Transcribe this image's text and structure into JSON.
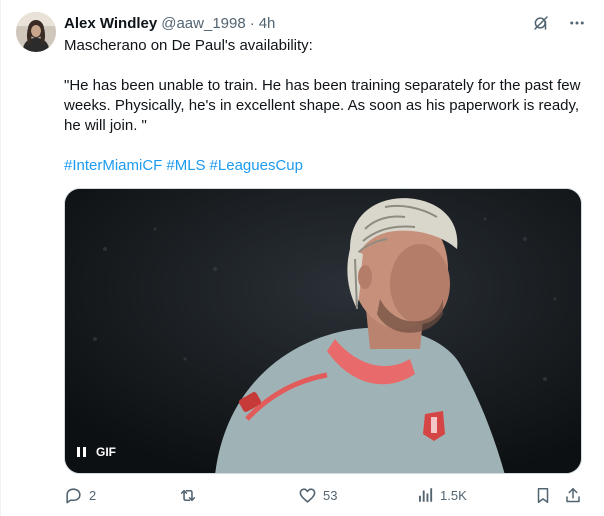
{
  "tweet": {
    "author_name": "Alex Windley",
    "handle": "@aaw_1998",
    "separator": "·",
    "time": "4h",
    "text_intro": "Mascherano on De Paul's availability:",
    "text_quote": "\"He has been unable to train. He has been training separately for the past few weeks. Physically, he's in excellent shape. As soon as his paperwork is ready, he will join. \"",
    "hashtags": [
      "#InterMiamiCF",
      "#MLS",
      "#LeaguesCup"
    ]
  },
  "media": {
    "type": "gif",
    "badge_label": "GIF",
    "state": "playing"
  },
  "actions": {
    "reply_count": "2",
    "retweet_count": "",
    "like_count": "53",
    "views_count": "1.5K"
  },
  "icons": {
    "grok": "grok-icon",
    "more": "more-icon",
    "reply": "reply-icon",
    "retweet": "retweet-icon",
    "like": "like-icon",
    "views": "views-icon",
    "bookmark": "bookmark-icon",
    "share": "share-icon"
  },
  "colors": {
    "text": "#0f1419",
    "muted": "#536471",
    "link": "#1d9bf0"
  }
}
